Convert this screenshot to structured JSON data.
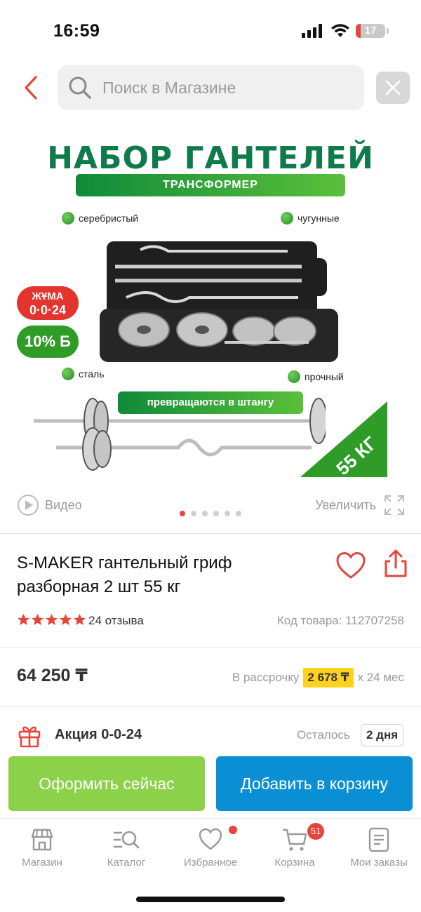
{
  "status_bar": {
    "time": "16:59",
    "battery": "17",
    "battery_level": 0.17,
    "battery_color": "#e5453a"
  },
  "search": {
    "placeholder": "Поиск в Магазине"
  },
  "hero": {
    "title": "НАБОР ГАНТЕЛЕЙ",
    "subtitle": "ТРАНСФОРМЕР",
    "features": [
      "серебристый",
      "чугунные",
      "сталь",
      "прочный"
    ],
    "jum_line1": "ЖҰМА",
    "jum_line2": "0·0·24",
    "bonus": "10% Б",
    "promo": "превращаются в штангу",
    "weight": "55 КГ"
  },
  "media": {
    "video": "Видео",
    "zoom": "Увеличить",
    "active_slide": 1,
    "slide_count": 6
  },
  "product": {
    "title": "S-MAKER гантельный гриф разборная 2 шт 55 кг",
    "rating": 5,
    "reviews": "24 отзыва",
    "sku": "Код товара: 112707258"
  },
  "price": {
    "value": "64 250 ₸",
    "installment_label": "В рассрочку",
    "installment_value": "2 678 ₸",
    "installment_term": "х 24 мес"
  },
  "promo": {
    "name": "Акция 0-0-24",
    "left_label": "Осталось",
    "days": "2 дня"
  },
  "actions": {
    "buy_now": "Оформить сейчас",
    "add_to_cart": "Добавить в корзину"
  },
  "tabs": [
    {
      "label": "Магазин",
      "icon": "shop-icon"
    },
    {
      "label": "Каталог",
      "icon": "catalog-icon"
    },
    {
      "label": "Избранное",
      "icon": "heart-icon"
    },
    {
      "label": "Корзина",
      "icon": "cart-icon"
    },
    {
      "label": "Мои заказы",
      "icon": "orders-icon"
    }
  ],
  "cart_count": "51",
  "colors": {
    "accent_red": "#e5453a",
    "buy_green": "#8bd24a",
    "cart_blue": "#0b8fd4",
    "installment_yellow": "#ffd21f",
    "brand_green": "#0f7a4a"
  }
}
